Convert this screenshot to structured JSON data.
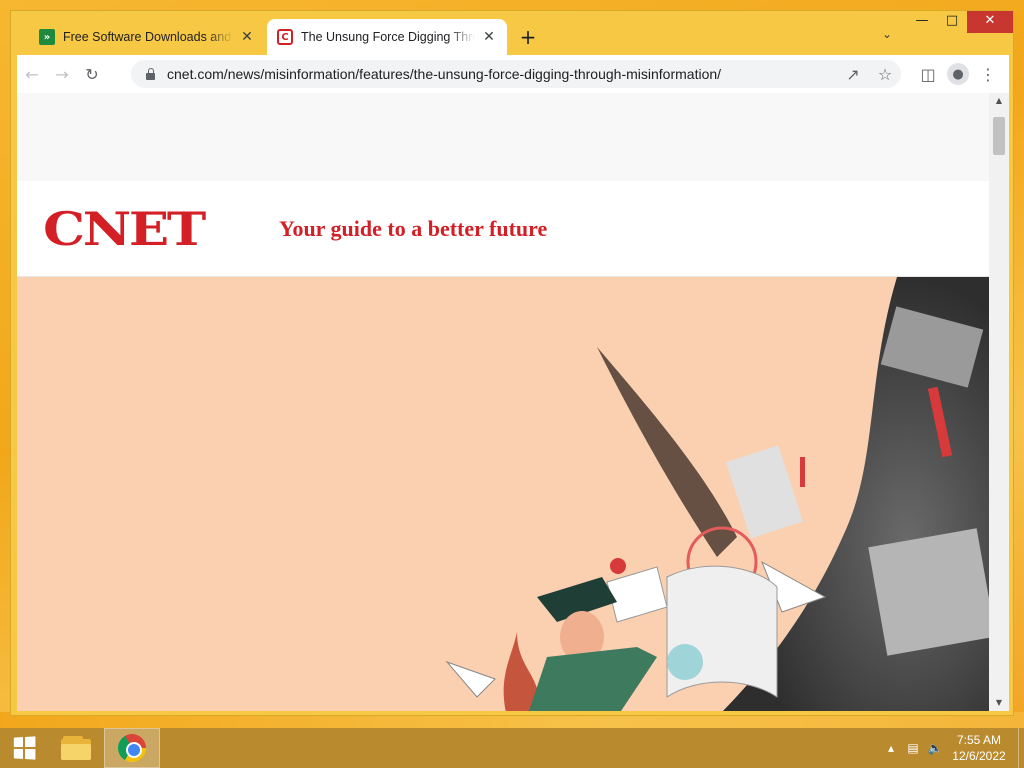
{
  "browser": {
    "tabs": [
      {
        "title": "Free Software Downloads and Reviews",
        "favicon": "softonic-icon",
        "active": false
      },
      {
        "title": "The Unsung Force Digging Through Misinformation",
        "favicon": "cnet-icon",
        "active": true
      }
    ],
    "new_tab_label": "+",
    "url": "cnet.com/news/misinformation/features/the-unsung-force-digging-through-misinformation/"
  },
  "page": {
    "logo_text": "CNET",
    "tagline": "Your guide to a better future",
    "brand_color": "#d31f26",
    "hero_bg": "#fbd0b0"
  },
  "taskbar": {
    "time": "7:55 AM",
    "date": "12/6/2022",
    "apps": [
      "file-explorer",
      "google-chrome"
    ]
  }
}
